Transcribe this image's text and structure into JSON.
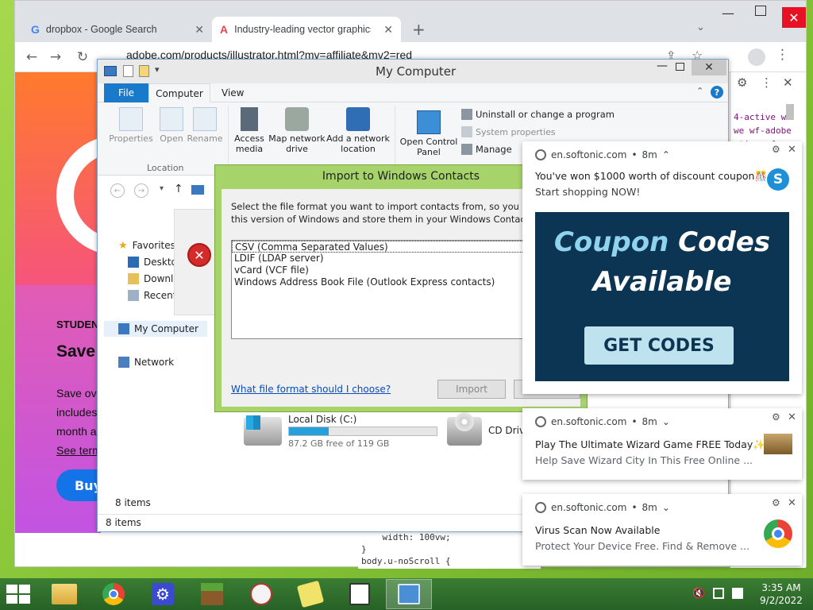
{
  "browser": {
    "tabs": [
      {
        "label": "dropbox - Google Search",
        "icon": "google-icon"
      },
      {
        "label": "Industry-leading vector graphics",
        "icon": "adobe-icon"
      }
    ],
    "url": "adobe.com/products/illustrator.html?mv=affiliate&mv2=red"
  },
  "adobe_page": {
    "student_label": "STUDEN",
    "save_label": "Save",
    "body_lines": [
      "Save ove",
      "includes",
      "month a"
    ],
    "see_link": "See term",
    "buy_button": "Buy"
  },
  "devtools": {
    "code_lines": [
      "4-active w",
      "we wf-adobe",
      "ative wf-ro"
    ],
    "bottom_code": [
      "    width: 100vw;",
      "}",
      "body.u-noScroll {"
    ]
  },
  "explorer": {
    "title": "My Computer",
    "ribbon_tabs": [
      "File",
      "Computer",
      "View"
    ],
    "location_group": "Location",
    "buttons": {
      "properties": "Properties",
      "open": "Open",
      "rename": "Rename",
      "access_media": "Access media",
      "map_network": "Map network drive",
      "add_network": "Add a network location",
      "control_panel": "Open Control Panel",
      "uninstall": "Uninstall or change a program",
      "system_properties": "System properties",
      "manage": "Manage"
    },
    "sidebar": {
      "favorites": "Favorites",
      "items": [
        "Deskto",
        "Downlo",
        "Recent"
      ],
      "my_computer": "My Computer",
      "network": "Network"
    },
    "drives": {
      "local_disk": "Local Disk (C:)",
      "local_disk_free": "87.2 GB free of 119 GB",
      "local_disk_used_fraction": 0.27,
      "cd_drive": "CD Drive"
    },
    "item_count": "8 items",
    "status_count": "8 items"
  },
  "dialog": {
    "title": "Import to Windows Contacts",
    "instructions": "Select the file format you want to import contacts from, so you can vi",
    "instructions2": "this version of Windows and store them in your Windows Contacts fol",
    "formats": [
      "CSV (Comma Separated Values)",
      "LDIF (LDAP server)",
      "vCard (VCF file)",
      "Windows Address Book File (Outlook Express contacts)"
    ],
    "help_link": "What file format should I choose?",
    "import_button": "Import"
  },
  "notifications": [
    {
      "source": "en.softonic.com",
      "time": "8m",
      "title": "You've won $1000 worth of discount coupon🎊",
      "body": "Start shopping NOW!",
      "banner_line1a": "Coupon",
      "banner_line1b": "Codes",
      "banner_line2": "Available",
      "banner_button": "GET CODES"
    },
    {
      "source": "en.softonic.com",
      "time": "8m",
      "title": "Play The Ultimate Wizard Game FREE Today✨",
      "body": "Help Save Wizard City In This Free Online ..."
    },
    {
      "source": "en.softonic.com",
      "time": "8m",
      "title": "Virus Scan Now Available",
      "body": "Protect Your Device Free. Find & Remove ..."
    }
  ],
  "taskbar": {
    "time": "3:35 AM",
    "date": "9/2/2022"
  },
  "colors": {
    "dialog_frame": "#a6d36a",
    "file_tab": "#1979ca",
    "taskbar": "#2f6d2c",
    "coupon_bg": "#0c3553",
    "coupon_button": "#bfe3ee"
  }
}
